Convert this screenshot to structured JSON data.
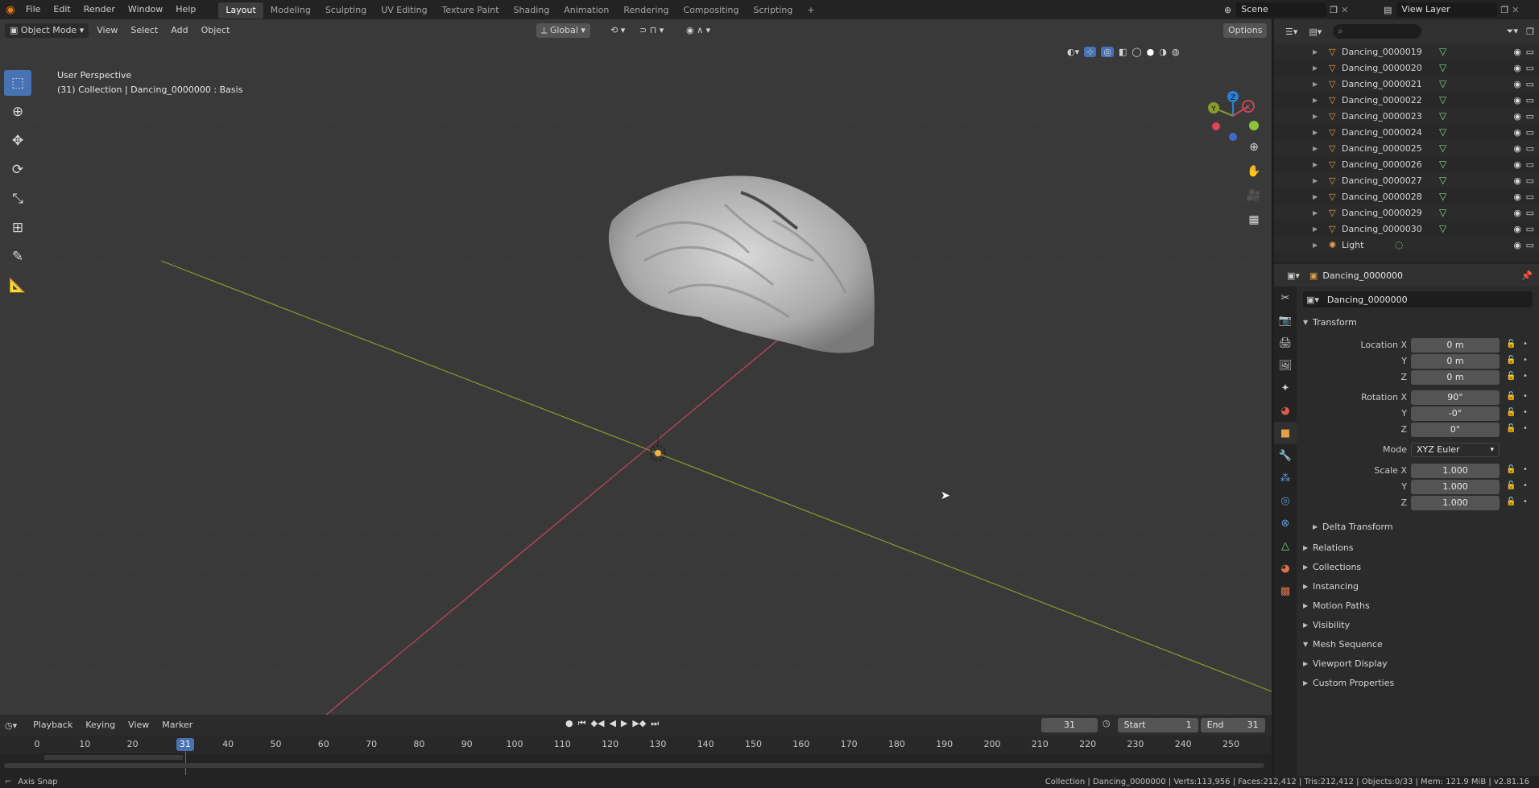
{
  "menus": [
    "File",
    "Edit",
    "Render",
    "Window",
    "Help"
  ],
  "workspaces": [
    "Layout",
    "Modeling",
    "Sculpting",
    "UV Editing",
    "Texture Paint",
    "Shading",
    "Animation",
    "Rendering",
    "Compositing",
    "Scripting"
  ],
  "active_workspace": "Layout",
  "add_workspace": "+",
  "scene": {
    "label": "Scene",
    "view_layer": "View Layer"
  },
  "viewport": {
    "mode": "Object Mode",
    "menus": [
      "View",
      "Select",
      "Add",
      "Object"
    ],
    "transform_orientation": "Global",
    "options_label": "Options",
    "perspective_label": "User Perspective",
    "context_label": "(31) Collection | Dancing_0000000 : Basis",
    "gizmo_axes": [
      "X",
      "Y",
      "Z"
    ]
  },
  "timeline": {
    "menus": [
      "Playback",
      "Keying",
      "View",
      "Marker"
    ],
    "current_frame": "31",
    "start_label": "Start",
    "start": "1",
    "end_label": "End",
    "end": "31",
    "ticks": [
      "0",
      "10",
      "20",
      "31",
      "40",
      "50",
      "60",
      "70",
      "80",
      "90",
      "100",
      "110",
      "120",
      "130",
      "140",
      "150",
      "160",
      "170",
      "180",
      "190",
      "200",
      "210",
      "220",
      "230",
      "240",
      "250"
    ]
  },
  "outliner": {
    "items": [
      {
        "name": "Dancing_0000019"
      },
      {
        "name": "Dancing_0000020"
      },
      {
        "name": "Dancing_0000021"
      },
      {
        "name": "Dancing_0000022"
      },
      {
        "name": "Dancing_0000023"
      },
      {
        "name": "Dancing_0000024"
      },
      {
        "name": "Dancing_0000025"
      },
      {
        "name": "Dancing_0000026"
      },
      {
        "name": "Dancing_0000027"
      },
      {
        "name": "Dancing_0000028"
      },
      {
        "name": "Dancing_0000029"
      },
      {
        "name": "Dancing_0000030"
      },
      {
        "name": "Light"
      }
    ]
  },
  "properties": {
    "object_name": "Dancing_0000000",
    "datablock_name": "Dancing_0000000",
    "transform_label": "Transform",
    "location": {
      "label_x": "Location X",
      "x": "0 m",
      "y": "0 m",
      "z": "0 m"
    },
    "rotation": {
      "label_x": "Rotation X",
      "x": "90°",
      "y": "-0°",
      "z": "0°"
    },
    "mode_label": "Mode",
    "mode": "XYZ Euler",
    "scale": {
      "label_x": "Scale X",
      "x": "1.000",
      "y": "1.000",
      "z": "1.000"
    },
    "axis_y": "Y",
    "axis_z": "Z",
    "delta_transform": "Delta Transform",
    "panels": [
      "Relations",
      "Collections",
      "Instancing",
      "Motion Paths",
      "Visibility",
      "Mesh Sequence",
      "Viewport Display",
      "Custom Properties"
    ]
  },
  "statusbar": {
    "left": "Axis Snap",
    "right": "Collection | Dancing_0000000 | Verts:113,956 | Faces:212,412 | Tris:212,412 | Objects:0/33 | Mem: 121.9 MiB | v2.81.16"
  },
  "colors": {
    "accent": "#4772b3",
    "x_axis": "#c5475a",
    "y_axis": "#8b9a2d",
    "z_axis": "#2f7fd4",
    "mesh_icon": "#e6a04a"
  }
}
